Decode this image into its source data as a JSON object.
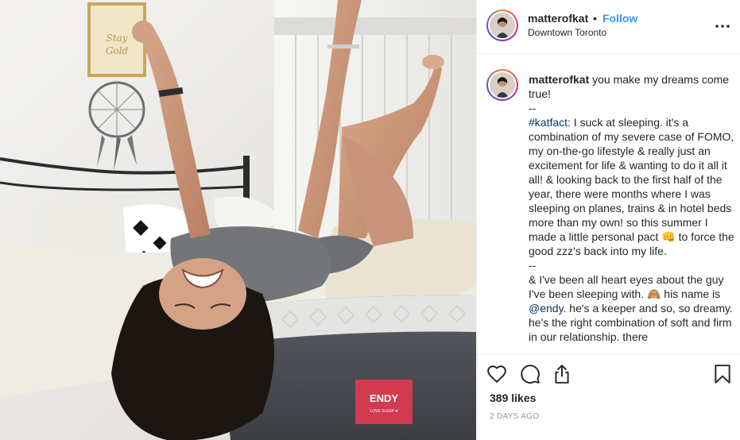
{
  "post": {
    "username": "matterofkat",
    "separator": "•",
    "follow_label": "Follow",
    "location": "Downtown Toronto",
    "more_label": "•••",
    "photo": {
      "label_brand": "ENDY",
      "label_tag": "LOVE SLEEP ♥",
      "frame_text": "Stay Gold"
    }
  },
  "caption": {
    "username": "matterofkat",
    "line1": "you make my dreams come true!",
    "sep1": "--",
    "hashtag": "#katfact",
    "p1": ": I suck at sleeping. it's a combination of my severe case of FOMO, my on-the-go lifestyle & really just an excitement for life & wanting to do it all it all! & looking back to the first half of the year, there were months where I was sleeping on planes, trains & in hotel beds more than my own! so this summer I made a little personal pact 👊 to force the good zzz's back into my life.",
    "sep2": "--",
    "p2a": "& I've been all heart eyes about the guy I've been sleeping with. 🙈 his name is ",
    "mention": "@endy",
    "p2b": ". he's a keeper and so, so dreamy. he's the right combination of soft and firm in our relationship. there"
  },
  "footer": {
    "likes": "389 likes",
    "timestamp": "2 DAYS AGO"
  },
  "colors": {
    "link": "#3897f0",
    "hashtag": "#003569",
    "text": "#262626",
    "muted": "#999999",
    "divider": "#efefef"
  },
  "icons": [
    "heart-icon",
    "comment-icon",
    "share-icon",
    "bookmark-icon",
    "more-icon"
  ]
}
